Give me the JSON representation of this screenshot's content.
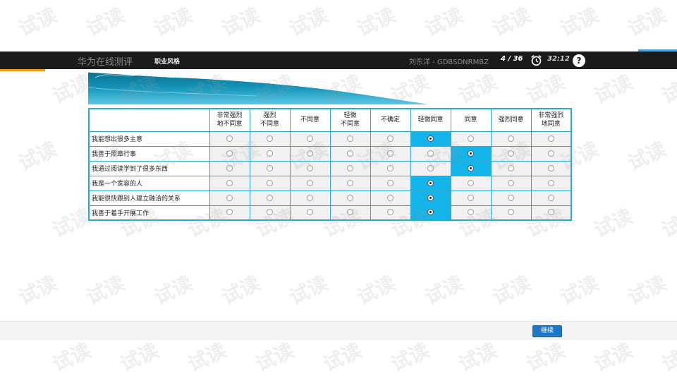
{
  "header": {
    "app_title": "华为在线测评",
    "section": "职业风格",
    "user": "刘东洋 - GDBSDNRMBZ",
    "progress": "4 / 36",
    "timer": "32:12",
    "help_symbol": "?"
  },
  "question_table": {
    "options": [
      "非常强烈\n地不同意",
      "强烈\n不同意",
      "不同意",
      "轻微\n不同意",
      "不确定",
      "轻微同意",
      "同意",
      "强烈同意",
      "非常强烈\n地同意"
    ],
    "rows": [
      {
        "statement": "我能想出很多主意",
        "selected": 5
      },
      {
        "statement": "我善于照章行事",
        "selected": 6
      },
      {
        "statement": "我通过阅读学到了很多东西",
        "selected": 6
      },
      {
        "statement": "我是一个宽容的人",
        "selected": 5
      },
      {
        "statement": "我能很快跟别人建立融洽的关系",
        "selected": 5
      },
      {
        "statement": "我善于着手开展工作",
        "selected": 5
      }
    ]
  },
  "footer": {
    "continue_label": "继续"
  },
  "watermark": "试读",
  "colors": {
    "top_bar": "#1b1b1b",
    "accent_orange": "#f39c12",
    "table_border": "#2aa9d0",
    "selected_cell": "#12b4ea",
    "continue_button": "#1e78c8"
  }
}
